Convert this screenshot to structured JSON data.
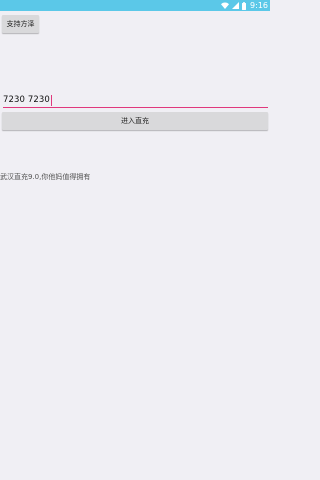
{
  "status_bar": {
    "time": "9:16",
    "icons": [
      "wifi-icon",
      "signal-icon",
      "battery-icon"
    ],
    "color": "#5bc8e8"
  },
  "support_button": {
    "label": "支持方泽"
  },
  "code_input": {
    "value": "7230 7230",
    "accent": "#e0387c"
  },
  "enter_button": {
    "label": "进入直充"
  },
  "footer": {
    "text": "武汉直充9.0,你他妈值得拥有"
  }
}
